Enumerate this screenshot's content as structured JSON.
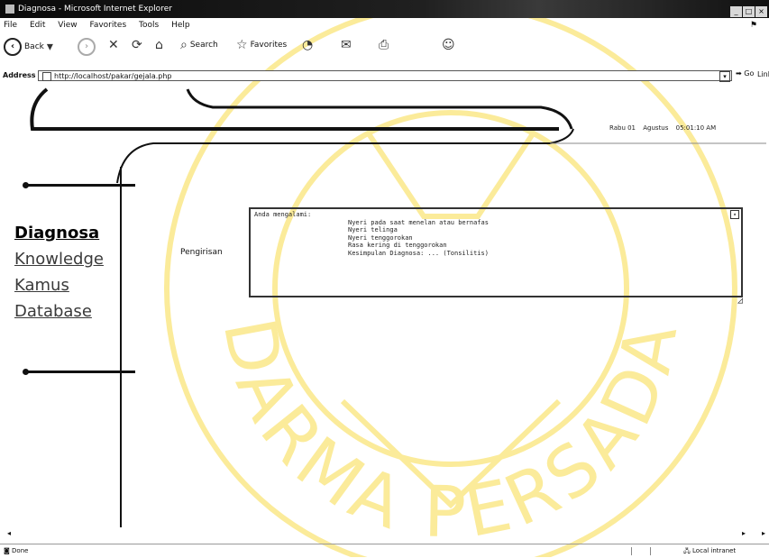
{
  "window": {
    "title": "Diagnosa - Microsoft Internet Explorer"
  },
  "menu": {
    "items": [
      "File",
      "Edit",
      "View",
      "Favorites",
      "Tools",
      "Help"
    ]
  },
  "toolbar": {
    "back": "Back",
    "search": "Search",
    "favorites": "Favorites"
  },
  "address": {
    "label": "Address",
    "url": "http://localhost/pakar/gejala.php",
    "go": "Go",
    "links": "Links"
  },
  "header": {
    "date_day": "Rabu 01",
    "date_month": "Agustus",
    "time": "05:01:10 AM"
  },
  "nav": {
    "items": [
      "Diagnosa",
      "Knowledge",
      "Kamus",
      "Database"
    ]
  },
  "form": {
    "label": "Pengirisan",
    "lines": [
      "Anda mengalami:",
      "Nyeri pada saat menelan atau bernafas",
      "Nyeri telinga",
      "Nyeri tenggorokan",
      "Rasa kering di tenggorokan",
      "Kesimpulan Diagnosa: ... (Tonsilitis)"
    ]
  },
  "status": {
    "left": "Done",
    "right": "Local intranet"
  },
  "watermark": {
    "text": "DARMA PERSADA"
  },
  "colors": {
    "watermark": "#fbeb9a",
    "titlebar": "#101010"
  }
}
